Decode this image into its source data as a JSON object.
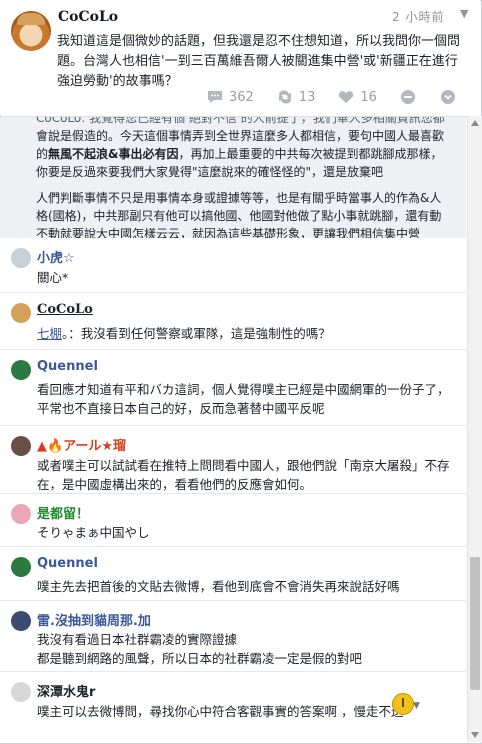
{
  "post": {
    "author": "CoCoLo",
    "time": "2 小時前",
    "text": "我知道這是個微妙的話題，但我還是忍不住想知道，所以我問你一個問題。台灣人也相信'一到三百萬維吾爾人被關進集中營'或'新疆正在進行強迫勞動'的故事嗎？",
    "stats": {
      "comments": "362",
      "shares": "13",
      "likes": "16"
    }
  },
  "partial_comment": {
    "line0": "CoCoLo: 我覺得您已經有個 絕對不信 的人前提了，我們華人多相關資訊您都",
    "para1_a": "會說是假造的。今天這個事情弄到全世界這麼多人都相信，要句中國人最喜歡的",
    "para1_bold": "無風不起浪&事出必有因",
    "para1_b": "，再加上最重要的中共每次被提到都跳腳成那樣，你要是反過來要我們大家覺得\"這麼說來的確怪怪的\"，還是放棄吧",
    "para2": "人們判斷事情不只是用事情本身或證據等等，也是有關乎時當事人的作為&人格(國格)，中共那副只有他可以搞他國、他國對他做了點小事就跳腳，還有動不動就要說大中國怎樣云云，就因為這些基礎形象，更讓我們相信集中營"
  },
  "comments": [
    {
      "name": "小虎☆",
      "text": "關心*"
    },
    {
      "name": "CoCoLo",
      "mention": "七棚",
      "text": "。：我沒看到任何警察或軍隊，這是強制性的嗎？"
    },
    {
      "name": "Quennel",
      "text": "看回應才知道有平和バカ這詞，個人覺得噗主已經是中國網軍的一份子了，平常也不直接日本自己的好，反而急著替中國平反呢"
    },
    {
      "name": "▲🔥アール★瑠",
      "text": "或者噗主可以試試看在推特上問問看中國人，跟他們說「南京大屠殺」不存在，是中國虛構出來的，看看他們的反應會如何。"
    },
    {
      "name": "是都留！",
      "text": "そりゃまぁ中国やし"
    },
    {
      "name": "Quennel",
      "text": "噗主先去把首後的文貼去微博，看他到底會不會消失再來說話好嗎"
    },
    {
      "name": "雷.沒抽到貓周那.加",
      "text": "我沒有看過日本社群霸凌的實際證據\n都是聽到網路的風聲，所以日本的社群霸凌一定是假的對吧"
    },
    {
      "name": "深潭水鬼r",
      "text": "噗主可以去微博問，尋找你心中符合客觀事實的答案啊 ，慢走不送"
    }
  ]
}
